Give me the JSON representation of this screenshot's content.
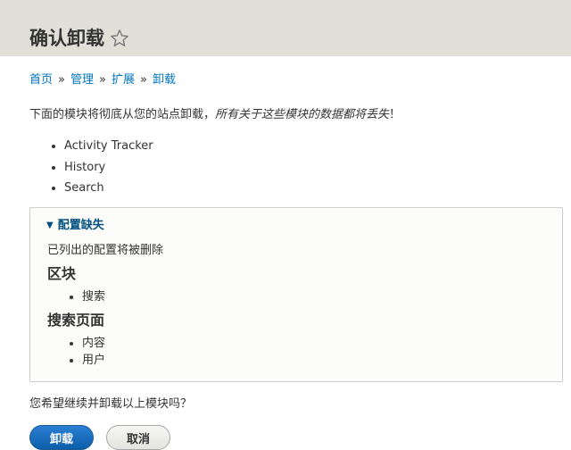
{
  "page": {
    "title": "确认卸载",
    "favorite_icon": "star-outline-icon"
  },
  "breadcrumb": {
    "items": [
      "首页",
      "管理",
      "扩展",
      "卸载"
    ],
    "separator": "»"
  },
  "intro": {
    "text": "下面的模块将彻底从您的站点卸载，",
    "emphasis": "所有关于这些模块的数据都将丢失",
    "suffix": "！"
  },
  "modules": [
    "Activity Tracker",
    "History",
    "Search"
  ],
  "config": {
    "summary": "配置缺失",
    "toggle_icon": "triangle-down-icon",
    "description": "已列出的配置将被删除",
    "groups": [
      {
        "title": "区块",
        "items": [
          "搜索"
        ]
      },
      {
        "title": "搜索页面",
        "items": [
          "内容",
          "用户"
        ]
      }
    ]
  },
  "question": "您希望继续并卸载以上模块吗？",
  "actions": {
    "confirm_label": "卸载",
    "cancel_label": "取消"
  },
  "colors": {
    "link": "#0074bd",
    "header_bg": "#e0e0d8",
    "primary_button": "#0b5ea8",
    "summary_text": "#004f80"
  }
}
